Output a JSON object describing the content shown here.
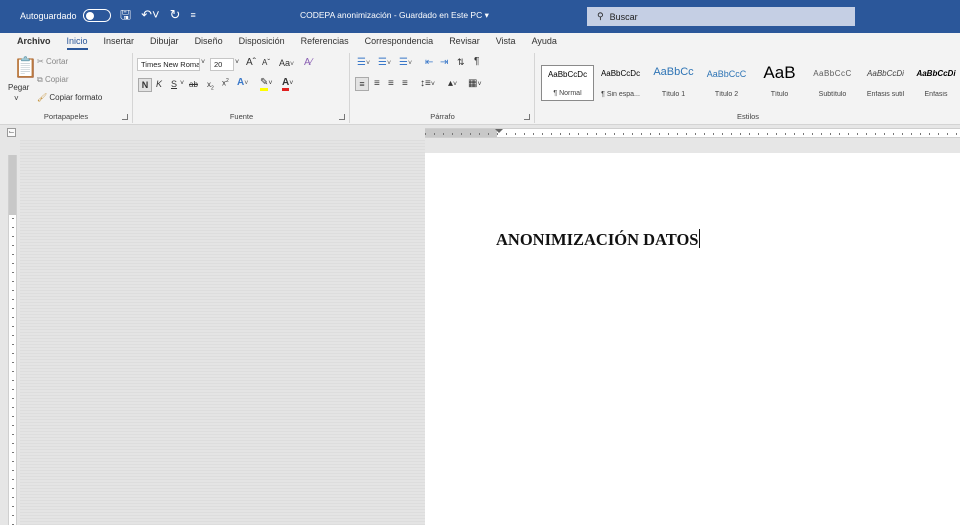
{
  "titlebar": {
    "autosave_label": "Autoguardado",
    "doc_title": "CODEPA anonimización - Guardado en Este PC",
    "search_placeholder": "Buscar",
    "quick_icons": [
      "save-icon",
      "undo-icon",
      "redo-icon",
      "customize-icon"
    ]
  },
  "menu": {
    "tabs": [
      "Archivo",
      "Inicio",
      "Insertar",
      "Dibujar",
      "Diseño",
      "Disposición",
      "Referencias",
      "Correspondencia",
      "Revisar",
      "Vista",
      "Ayuda"
    ],
    "active": "Inicio"
  },
  "ribbon": {
    "clipboard": {
      "label": "Portapapeles",
      "paste": "Pegar",
      "cut": "Cortar",
      "copy": "Copiar",
      "format_painter": "Copiar formato"
    },
    "font": {
      "label": "Fuente",
      "font_name": "Times New Roma",
      "font_size": "20",
      "change_case": "Aa",
      "bold": "N",
      "italic": "K",
      "underline": "S",
      "strike": "ab",
      "subscript": "x",
      "superscript": "x"
    },
    "paragraph": {
      "label": "Párrafo"
    },
    "styles": {
      "label": "Estilos",
      "items": [
        {
          "sample": "AaBbCcDc",
          "name": "¶ Normal",
          "color": "#000000"
        },
        {
          "sample": "AaBbCcDc",
          "name": "¶ Sin espa...",
          "color": "#000000"
        },
        {
          "sample": "AaBbCc",
          "name": "Título 1",
          "color": "#2e74b5"
        },
        {
          "sample": "AaBbCcC",
          "name": "Título 2",
          "color": "#2e74b5"
        },
        {
          "sample": "AaB",
          "name": "Título",
          "color": "#000000"
        },
        {
          "sample": "AaBbCcC",
          "name": "Subtítulo",
          "color": "#595959"
        },
        {
          "sample": "AaBbCcDi",
          "name": "Énfasis sutil",
          "color": "#404040"
        },
        {
          "sample": "AaBbCcDi",
          "name": "Énfasis",
          "color": "#000000"
        }
      ]
    }
  },
  "document": {
    "heading": "ANONIMIZACIÓN DATOS"
  },
  "colors": {
    "titlebar": "#2b579a",
    "search": "#c5cfe4",
    "ribbon": "#f3f3f3",
    "accent": "#2b579a"
  }
}
